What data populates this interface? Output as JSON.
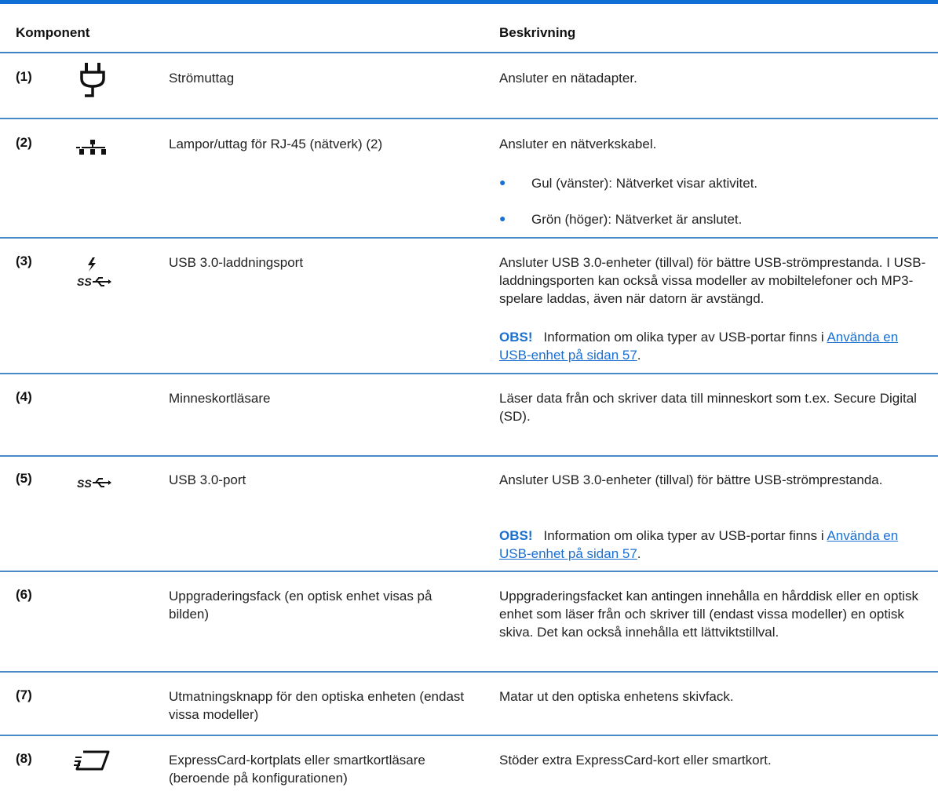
{
  "header": {
    "col1": "Komponent",
    "col2": "Beskrivning"
  },
  "rows": [
    {
      "num": "(1)",
      "icon": "power-plug-icon",
      "component": "Strömuttag",
      "description": "Ansluter en nätadapter."
    },
    {
      "num": "(2)",
      "icon": "network-icon",
      "component": "Lampor/uttag för RJ-45 (nätverk) (2)",
      "description": "Ansluter en nätverkskabel.",
      "bullets": [
        "Gul (vänster): Nätverket visar aktivitet.",
        "Grön (höger): Nätverket är anslutet."
      ]
    },
    {
      "num": "(3)",
      "icon": "usb-3-charging-icon",
      "component": "USB 3.0-laddningsport",
      "description": "Ansluter USB 3.0-enheter (tillval) för bättre USB-strömprestanda. I USB-laddningsporten kan också vissa modeller av mobiltelefoner och MP3-spelare laddas, även när datorn är avstängd.",
      "note": {
        "label": "OBS!",
        "text": "Information om olika typer av USB-portar finns i",
        "link": "Använda en USB-enhet på sidan 57",
        "end": "."
      }
    },
    {
      "num": "(4)",
      "component": "Minneskortläsare",
      "description": "Läser data från och skriver data till minneskort som t.ex. Secure Digital (SD)."
    },
    {
      "num": "(5)",
      "icon": "usb-3-icon",
      "component": "USB 3.0-port",
      "description": "Ansluter USB 3.0-enheter (tillval) för bättre USB-strömprestanda.",
      "note": {
        "label": "OBS!",
        "text": "Information om olika typer av USB-portar finns i",
        "link": "Använda en USB-enhet på sidan 57",
        "end": "."
      }
    },
    {
      "num": "(6)",
      "component": "Uppgraderingsfack (en optisk enhet visas på bilden)",
      "description": "Uppgraderingsfacket kan antingen innehålla en hårddisk eller en optisk enhet som läser från och skriver till (endast vissa modeller) en optisk skiva. Det kan också innehålla ett lättviktstillval."
    },
    {
      "num": "(7)",
      "component": "Utmatningsknapp för den optiska enheten (endast vissa modeller)",
      "description": "Matar ut den optiska enhetens skivfack."
    },
    {
      "num": "(8)",
      "icon": "expresscard-icon",
      "component": "ExpressCard-kortplats eller smartkortläsare (beroende på konfigurationen)",
      "description": "Stöder extra ExpressCard-kort eller smartkort."
    }
  ]
}
